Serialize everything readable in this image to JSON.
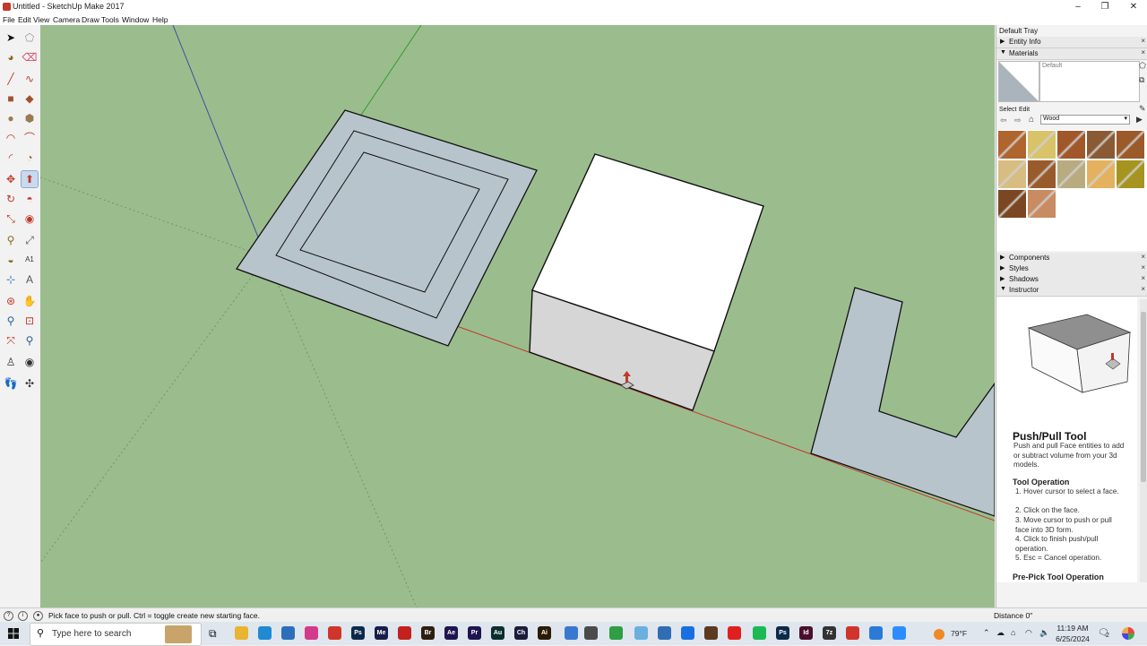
{
  "window": {
    "title": "Untitled - SketchUp Make 2017",
    "minimize": "–",
    "maximize": "❐",
    "close": "✕"
  },
  "menu": [
    "File",
    "Edit",
    "View",
    "Camera",
    "Draw",
    "Tools",
    "Window",
    "Help"
  ],
  "toolbar_icons": [
    "select-icon",
    "eraser-icon",
    "paint-bucket-icon",
    "eraser-alt-icon",
    "line-icon",
    "freehand-icon",
    "rectangle-icon",
    "rotated-rectangle-icon",
    "circle-icon",
    "polygon-icon",
    "arc-icon",
    "two-point-arc-icon",
    "three-point-arc-icon",
    "pie-icon",
    "move-icon",
    "push-pull-icon",
    "rotate-icon",
    "follow-me-icon",
    "scale-icon",
    "offset-icon",
    "tape-measure-icon",
    "dimension-icon",
    "protractor-icon",
    "text-icon",
    "axes-icon",
    "3d-text-icon",
    "orbit-icon",
    "pan-icon",
    "zoom-icon",
    "zoom-window-icon",
    "zoom-extents-icon",
    "previous-view-icon",
    "position-camera-icon",
    "look-around-icon",
    "walk-icon",
    "section-plane-icon"
  ],
  "tray": {
    "title": "Default Tray",
    "entity_info": "Entity Info",
    "materials": "Materials",
    "default_material": "Default",
    "select_tab": "Select",
    "edit_tab": "Edit",
    "collection": "Wood",
    "swatch_colors": [
      "#b0642e",
      "#d9c36a",
      "#a0582a",
      "#8a5a35",
      "#9a5a2a",
      "#d8bd82",
      "#9a5b2c",
      "#b9ab80",
      "#e4b25e",
      "#a5941f",
      "#7b4622",
      "#c98b62"
    ],
    "components": "Components",
    "styles": "Styles",
    "shadows": "Shadows",
    "instructor": "Instructor",
    "close_glyph": "×"
  },
  "instructor": {
    "title": "Push/Pull Tool",
    "description": "Push and pull Face entities to add or subtract volume from your 3d models.",
    "operation_heading": "Tool Operation",
    "steps": [
      "1. Hover cursor to select a face.",
      "2. Click on the face.",
      "3. Move cursor to push or pull face into 3D form.",
      "4. Click to finish push/pull operation.",
      "5. Esc = Cancel operation."
    ],
    "prepick_heading": "Pre-Pick Tool Operation"
  },
  "statusbar": {
    "message": "Pick face to push or pull.  Ctrl = toggle create new starting face.",
    "distance_label": "Distance",
    "distance_value": "0\""
  },
  "taskbar": {
    "search_placeholder": "Type here to search",
    "weather": "79°F",
    "time": "11:19 AM",
    "date": "6/25/2024",
    "notification_count": "2",
    "apps": [
      {
        "name": "file-explorer-icon",
        "label": "",
        "color": "#e8b431"
      },
      {
        "name": "edge-icon",
        "label": "",
        "color": "#1f8ad2"
      },
      {
        "name": "mail-icon",
        "label": "",
        "color": "#2c6fb8"
      },
      {
        "name": "photos-icon",
        "label": "",
        "color": "#d33a8a"
      },
      {
        "name": "sketchup-icon",
        "label": "",
        "color": "#d0352b"
      },
      {
        "name": "photoshop-icon",
        "label": "Ps",
        "color": "#0b2a4a"
      },
      {
        "name": "media-encoder-icon",
        "label": "Me",
        "color": "#1a1d4a"
      },
      {
        "name": "acrobat-icon",
        "label": "",
        "color": "#c2221d"
      },
      {
        "name": "bridge-icon",
        "label": "Br",
        "color": "#2d1e0e"
      },
      {
        "name": "after-effects-icon",
        "label": "Ae",
        "color": "#1e1550"
      },
      {
        "name": "premiere-icon",
        "label": "Pr",
        "color": "#1e1550"
      },
      {
        "name": "audition-icon",
        "label": "Au",
        "color": "#0b2e2e"
      },
      {
        "name": "character-animator-icon",
        "label": "Ch",
        "color": "#1b1b3a"
      },
      {
        "name": "illustrator-icon",
        "label": "Ai",
        "color": "#2b1a05"
      },
      {
        "name": "maps-icon",
        "label": "",
        "color": "#3a78d0"
      },
      {
        "name": "calculator-icon",
        "label": "",
        "color": "#4b4b4b"
      },
      {
        "name": "chrome-icon",
        "label": "",
        "color": "#2f9e44"
      },
      {
        "name": "notepad-icon",
        "label": "",
        "color": "#6ab0de"
      },
      {
        "name": "remote-icon",
        "label": "",
        "color": "#2f6db5"
      },
      {
        "name": "facebook-icon",
        "label": "",
        "color": "#1a6fe0"
      },
      {
        "name": "game-icon",
        "label": "",
        "color": "#5a3a20"
      },
      {
        "name": "youtube-icon",
        "label": "",
        "color": "#e02020"
      },
      {
        "name": "spotify-icon",
        "label": "",
        "color": "#1db954"
      },
      {
        "name": "photoshop2-icon",
        "label": "Ps",
        "color": "#0b2a4a"
      },
      {
        "name": "indesign-icon",
        "label": "Id",
        "color": "#4a0f2b"
      },
      {
        "name": "7zip-icon",
        "label": "7z",
        "color": "#333333"
      },
      {
        "name": "sketchup2-icon",
        "label": "",
        "color": "#d0352b"
      },
      {
        "name": "sketchup-active-icon",
        "label": "",
        "color": "#2b7bd6"
      },
      {
        "name": "zoom-icon",
        "label": "",
        "color": "#2d8cff"
      }
    ]
  }
}
